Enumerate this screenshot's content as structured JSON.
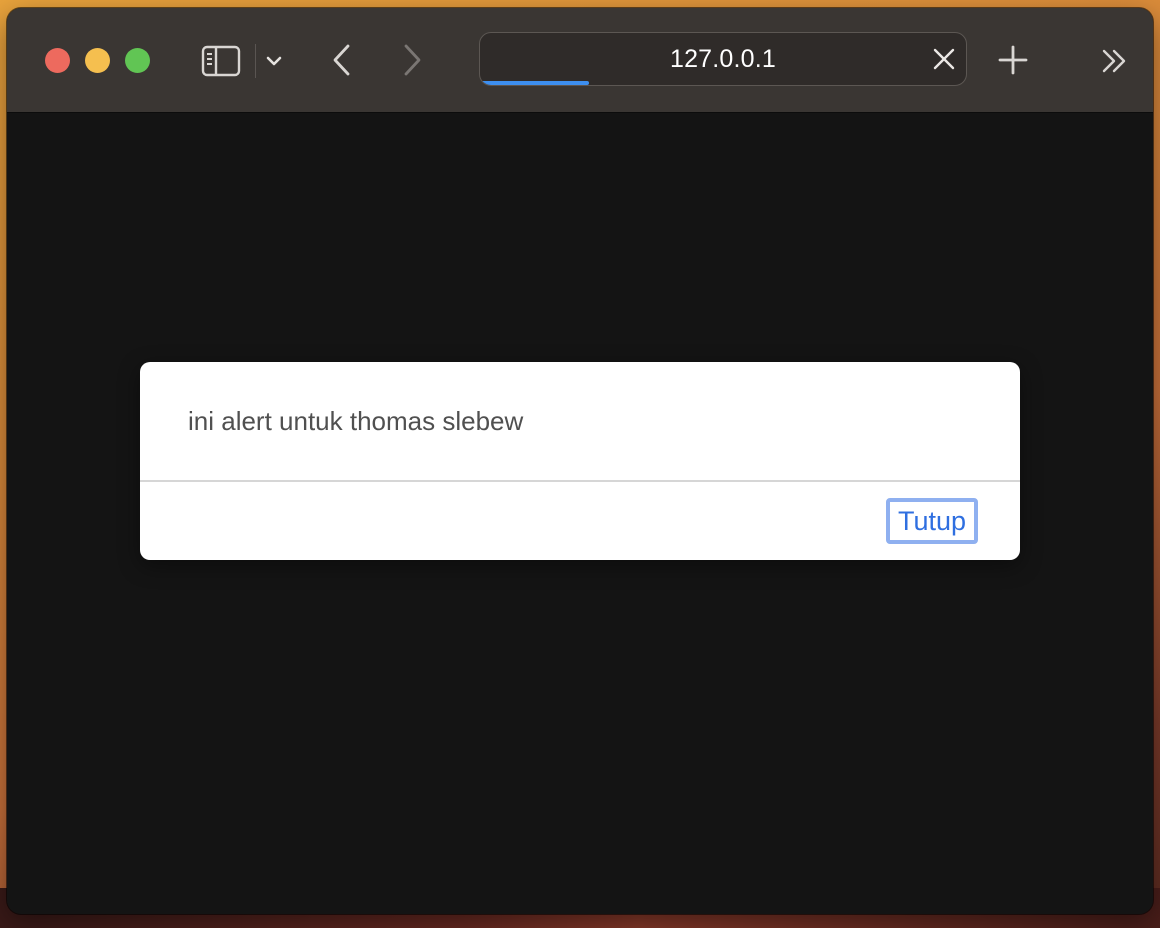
{
  "browser": {
    "address": {
      "url_text": "127.0.0.1",
      "load_progress_percent": 22.5
    },
    "icons": {
      "sidebar": "sidebar-icon",
      "tab_group_menu": "chevron-down-icon",
      "back": "chevron-left-icon",
      "forward": "chevron-right-icon",
      "clear": "close-icon",
      "new_tab": "plus-icon",
      "overflow": "double-chevron-right-icon"
    },
    "traffic_lights": {
      "close_color": "#ed6a5e",
      "minimize_color": "#f5bf4f",
      "zoom_color": "#61c554"
    }
  },
  "alert": {
    "message": "ini alert untuk thomas slebew",
    "close_label": "Tutup"
  },
  "colors": {
    "toolbar_bg": "#3a3633",
    "page_bg": "#141414",
    "accent": "#3d8ff0",
    "button_text": "#2f6fe0",
    "focus_ring": "#8fb0f0"
  }
}
